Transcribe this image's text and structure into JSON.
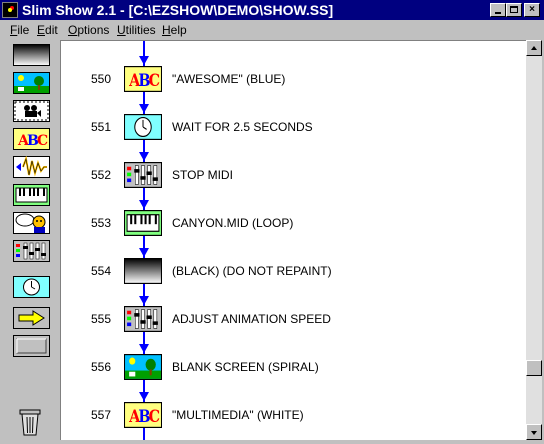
{
  "window": {
    "title": "Slim Show 2.1 - [C:\\EZSHOW\\DEMO\\SHOW.SS]",
    "controls": {
      "minimize": "minimize",
      "maximize": "maximize",
      "close": "×"
    }
  },
  "menu": {
    "items": [
      {
        "label": "File",
        "accel": "F",
        "rest": "ile"
      },
      {
        "label": "Edit",
        "accel": "E",
        "rest": "dit"
      },
      {
        "label": "Options",
        "accel": "O",
        "rest": "ptions"
      },
      {
        "label": "Utilities",
        "accel": "U",
        "rest": "tilities"
      },
      {
        "label": "Help",
        "accel": "H",
        "rest": "elp"
      }
    ]
  },
  "palette": {
    "tools": [
      "fade-screen-icon",
      "background-picture-icon",
      "animation-projector-icon",
      "text-abc-icon",
      "sound-wave-icon",
      "midi-keyboard-icon",
      "speech-character-icon",
      "control-panel-icon",
      "clock-icon",
      "arrow-goto-icon",
      "blank-button-icon"
    ],
    "trash": "trash-can-icon"
  },
  "script": {
    "rows": [
      {
        "num": "550",
        "icon": "text-abc-icon",
        "text": "\"AWESOME\" (BLUE)"
      },
      {
        "num": "551",
        "icon": "clock-icon",
        "text": "WAIT FOR 2.5 SECONDS"
      },
      {
        "num": "552",
        "icon": "control-panel-icon",
        "text": "STOP MIDI"
      },
      {
        "num": "553",
        "icon": "midi-keyboard-icon",
        "text": "CANYON.MID (LOOP)"
      },
      {
        "num": "554",
        "icon": "fade-screen-icon",
        "text": " (BLACK) (DO NOT REPAINT)"
      },
      {
        "num": "555",
        "icon": "control-panel-icon",
        "text": "ADJUST ANIMATION SPEED"
      },
      {
        "num": "556",
        "icon": "background-picture-icon",
        "text": "BLANK SCREEN (SPIRAL)"
      },
      {
        "num": "557",
        "icon": "text-abc-icon",
        "text": "\"MULTIMEDIA\" (WHITE)"
      }
    ]
  },
  "colors": {
    "titlebar": "#000080",
    "flow_arrow": "#0000ff",
    "abc_bg": "#ffff80",
    "clock_bg": "#80ffff",
    "keyboard_bg": "#80ff80"
  }
}
